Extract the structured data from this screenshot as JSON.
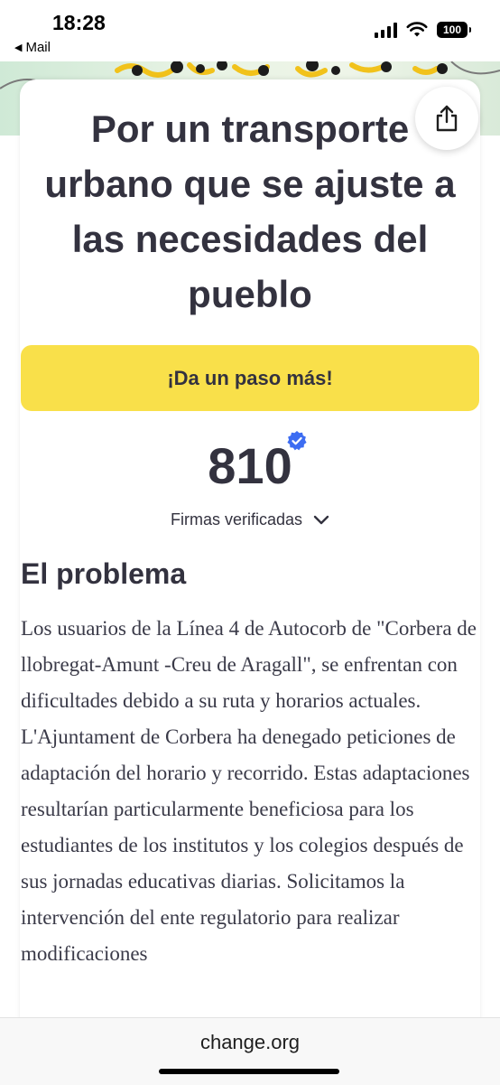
{
  "status_bar": {
    "time": "18:28",
    "back_label": "Mail",
    "battery": "100"
  },
  "petition": {
    "title": "Por un transporte urbano que se ajuste a las necesidades del pueblo",
    "cta_label": "¡Da un paso más!",
    "signature_count": "810",
    "signatures_label": "Firmas verificadas",
    "section_title": "El problema",
    "body": "Los usuarios de la Línea 4 de Autocorb de \"Corbera de llobregat-Amunt -Creu de Aragall\", se enfrentan con dificultades debido a su ruta y horarios actuales. L'Ajuntament de Corbera ha denegado peticiones de adaptación del horario y recorrido. Estas adaptaciones resultarían particularmente beneficiosa para los estudiantes de los institutos y los colegios después de sus jornadas educativas diarias. Solicitamos la intervención del ente regulatorio para realizar modificaciones"
  },
  "browser": {
    "url": "change.org"
  },
  "colors": {
    "cta_background": "#f9e04a",
    "verified_badge": "#3d6df2",
    "text_dark": "#33323f"
  }
}
